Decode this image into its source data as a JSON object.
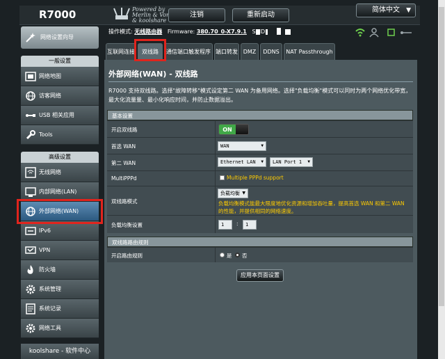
{
  "header": {
    "model": "R7000",
    "logo_lines": [
      "Powered by",
      "Merlin & Vortex",
      "& koolshare"
    ],
    "logout_label": "注销",
    "reboot_label": "重新启动",
    "language_label": "简体中文"
  },
  "status": {
    "mode_label": "操作模式:",
    "mode_value": "无线路由器",
    "firmware_label": "Firmware:",
    "firmware_value": "380.70_0-X7.9.1",
    "ssid_label": "SSID:"
  },
  "sidebar": {
    "quick_setup": "网络设置向导",
    "general_header": "一般设置",
    "general_items": [
      "网络地图",
      "访客网络",
      "USB 相关应用",
      "Tools"
    ],
    "advanced_header": "高级设置",
    "advanced_items": [
      "无线网络",
      "内部网络(LAN)",
      "外部网络(WAN)",
      "IPv6",
      "VPN",
      "防火墙",
      "系统管理",
      "系统记录",
      "网络工具"
    ],
    "active_item": "外部网络(WAN)",
    "koolshare": "koolshare - 软件中心"
  },
  "tabs": [
    "互联网连接",
    "双线路",
    "通信端口触发程序",
    "端口转发",
    "DMZ",
    "DDNS",
    "NAT Passthrough"
  ],
  "active_tab": "双线路",
  "main": {
    "title": "外部网络(WAN) - 双线路",
    "description": "R7000 支持双线路。选择\"故障转移\"模式设定第二 WAN 为备用网络。选择\"负载均衡\"模式可以同时为两个网络优化带宽，最大化流量量、最小化响应时间，并防止数据溢出。",
    "basic_header": "基本设置",
    "enable_label": "开启双线路",
    "enable_state": "ON",
    "primary_label": "首选 WAN",
    "primary_value": "WAN",
    "secondary_label": "第二 WAN",
    "secondary_value": "Ethernet LAN",
    "secondary_port": "LAN Port 1",
    "multippp_label": "MultiPPPd",
    "multippp_option": "Multiple PPPd support",
    "mode_label": "双线路模式",
    "mode_value": "负载均衡",
    "mode_warning": "负载均衡模式能最大限度地优化资源和增加吞吐量，提高首选 WAN 和第二 WAN 的性能，并提供相同的网络速度。",
    "lb_label": "负载均衡设置",
    "lb_value1": "1",
    "lb_colon": ":",
    "lb_value2": "1",
    "routing_header": "双线路路由规则",
    "routing_label": "开启路由规则",
    "routing_yes": "是",
    "routing_no": "否",
    "apply_label": "应用本页面设置"
  },
  "colors": {
    "accent_green": "#41a848",
    "warning_yellow": "#ffcc00",
    "highlight_red": "#e0241d"
  }
}
